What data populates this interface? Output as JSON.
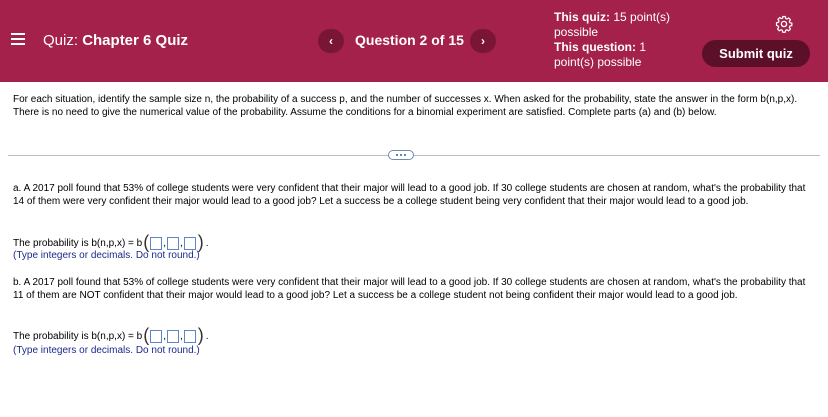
{
  "header": {
    "menu_icon": "hamburger-menu-icon",
    "quiz_prefix": "Quiz:",
    "quiz_name": "Chapter 6 Quiz",
    "prev_symbol": "‹",
    "next_symbol": "›",
    "question_label": "Question 2 of 15",
    "quiz_points_label": "This quiz:",
    "quiz_points_value": "15 point(s) possible",
    "question_points_label": "This question:",
    "question_points_value": "1 point(s) possible",
    "settings_icon": "gear-icon",
    "submit_label": "Submit quiz",
    "colors": {
      "bar": "#a3214a",
      "button": "#5c0f29"
    }
  },
  "instructions": "For each situation, identify the sample size n, the probability of a success p, and the number of successes x. When asked for the probability, state the answer in the form b(n,p,x). There is no need to give the numerical value of the probability. Assume the conditions for a binomial experiment are satisfied. Complete parts (a) and (b) below.",
  "parts": {
    "a": {
      "text": "a. A 2017 poll found that 53% of college students were very confident that their major will lead to a good job. If 30 college students are chosen at random, what's the probability that 14 of them were very confident their major would lead to a good job? Let a success be a college student being very confident that their major would lead to a good job.",
      "answer_prefix": "The probability is b(n,p,x) = b",
      "hint": "(Type integers or decimals. Do not round.)"
    },
    "b": {
      "text": "b. A 2017 poll found that 53% of college students were very confident that their major will lead to a good job. If 30 college students are chosen at random, what's the probability that 11 of them are NOT confident that their major would lead to a good job? Let a success be a college student not being confident their major would lead to a good job.",
      "answer_prefix": "The probability is b(n,p,x) = b",
      "hint": "(Type integers or decimals. Do not round.)"
    }
  },
  "punctuation": {
    "open_paren": "(",
    "close_paren": ")",
    "comma": ",",
    "period": "."
  }
}
